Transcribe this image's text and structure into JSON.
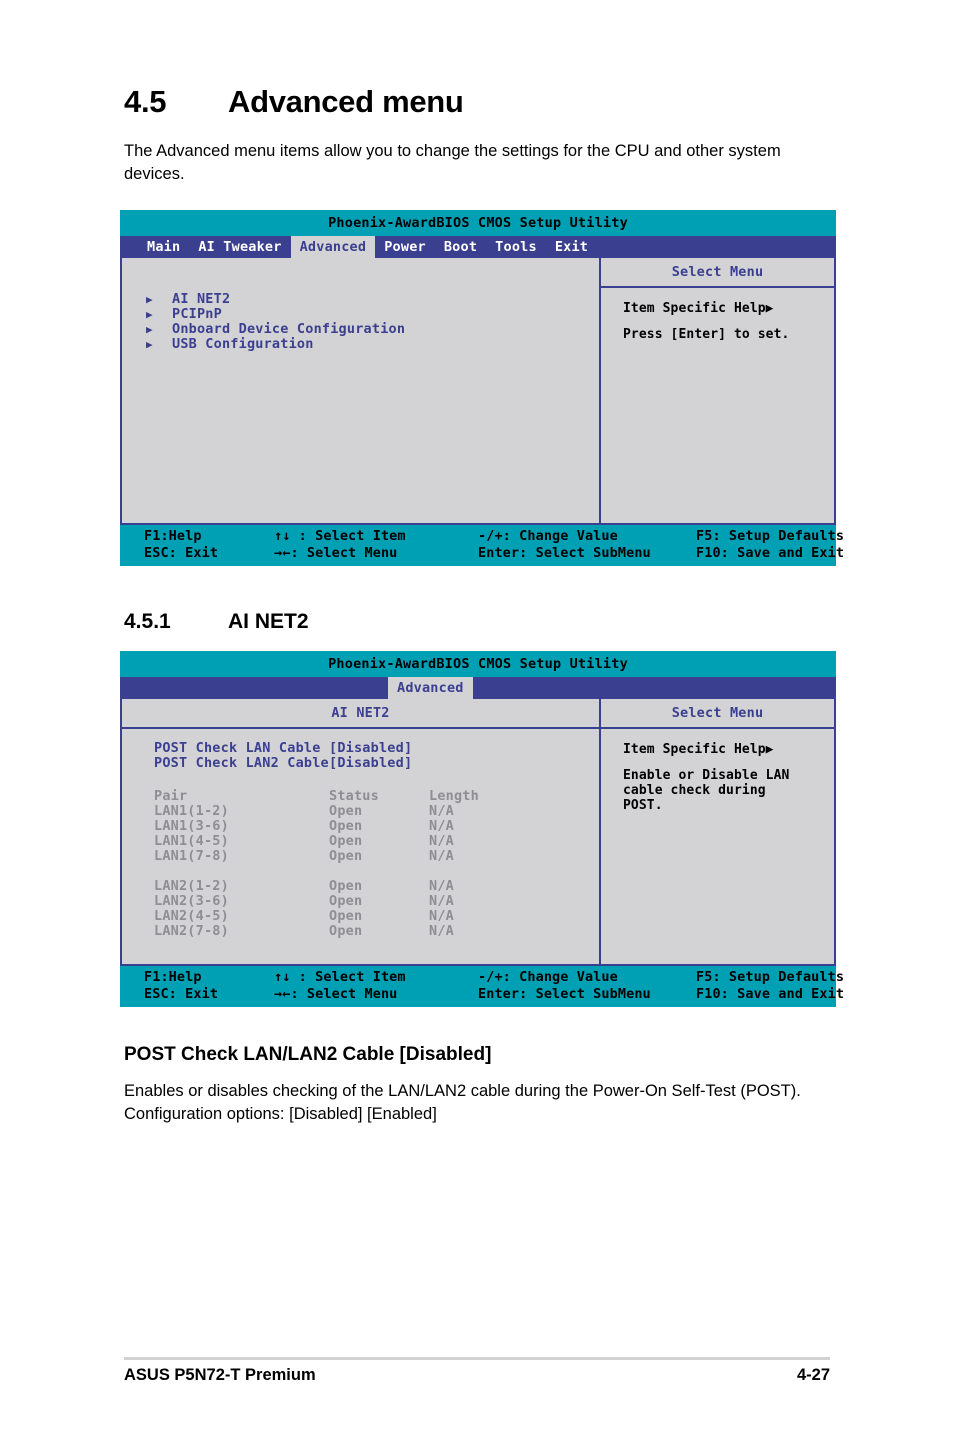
{
  "document": {
    "section_45": {
      "number": "4.5",
      "title": "Advanced menu"
    },
    "intro_paragraph": "The Advanced menu items allow you to change the settings for the CPU and other system devices.",
    "section_451": {
      "number": "4.5.1",
      "title": "AI NET2"
    },
    "post_heading": "POST Check LAN/LAN2 Cable [Disabled]",
    "post_paragraph": "Enables or disables checking of the LAN/LAN2 cable during the Power-On Self-Test (POST). Configuration options: [Disabled] [Enabled]",
    "footer_left": "ASUS P5N72-T Premium",
    "footer_right": "4-27"
  },
  "bios_common": {
    "utility_title": "Phoenix-AwardBIOS CMOS Setup Utility",
    "select_menu_label": "Select Menu",
    "item_specific_help": "Item Specific Help▶",
    "arrow_glyph": "▶",
    "footer": {
      "row1": {
        "c1": "F1:Help",
        "c2": "↑↓ : Select Item",
        "c3": "-/+: Change Value",
        "c4": "F5: Setup Defaults"
      },
      "row2": {
        "c1": "ESC: Exit",
        "c2": "→←: Select Menu",
        "c3": "Enter: Select SubMenu",
        "c4": "F10: Save and Exit"
      }
    }
  },
  "bios_screen_1": {
    "tabs": [
      {
        "label": "Main",
        "active": false
      },
      {
        "label": "AI Tweaker",
        "active": false
      },
      {
        "label": "Advanced",
        "active": true
      },
      {
        "label": "Power",
        "active": false
      },
      {
        "label": "Boot",
        "active": false
      },
      {
        "label": "Tools",
        "active": false
      },
      {
        "label": "Exit",
        "active": false
      }
    ],
    "menu_items": [
      {
        "label": "AI NET2"
      },
      {
        "label": "PCIPnP"
      },
      {
        "label": "Onboard Device Configuration"
      },
      {
        "label": "USB Configuration"
      }
    ],
    "help_text": "Press [Enter] to set."
  },
  "bios_screen_2": {
    "active_tab": "Advanced",
    "panel_title": "AI NET2",
    "options": [
      {
        "name": "POST Check LAN Cable",
        "value": "[Disabled]"
      },
      {
        "name": "POST Check LAN2 Cable",
        "value": "[Disabled]"
      }
    ],
    "pair_table": {
      "headers": {
        "c1": "Pair",
        "c2": "Status",
        "c3": "Length"
      },
      "rows": [
        {
          "c1": "LAN1(1-2)",
          "c2": "Open",
          "c3": "N/A"
        },
        {
          "c1": "LAN1(3-6)",
          "c2": "Open",
          "c3": "N/A"
        },
        {
          "c1": "LAN1(4-5)",
          "c2": "Open",
          "c3": "N/A"
        },
        {
          "c1": "LAN1(7-8)",
          "c2": "Open",
          "c3": "N/A"
        },
        {
          "c1": "LAN2(1-2)",
          "c2": "Open",
          "c3": "N/A"
        },
        {
          "c1": "LAN2(3-6)",
          "c2": "Open",
          "c3": "N/A"
        },
        {
          "c1": "LAN2(4-5)",
          "c2": "Open",
          "c3": "N/A"
        },
        {
          "c1": "LAN2(7-8)",
          "c2": "Open",
          "c3": "N/A"
        }
      ]
    },
    "help_text": "Enable or Disable LAN\ncable check during\nPOST."
  },
  "colors": {
    "title_bar": "#00a0b4",
    "menu_bar": "#3b3f8f",
    "panel_bg": "#d3d3d6",
    "accent_text": "#3b3f8f",
    "disabled_text": "#8e8e93"
  }
}
